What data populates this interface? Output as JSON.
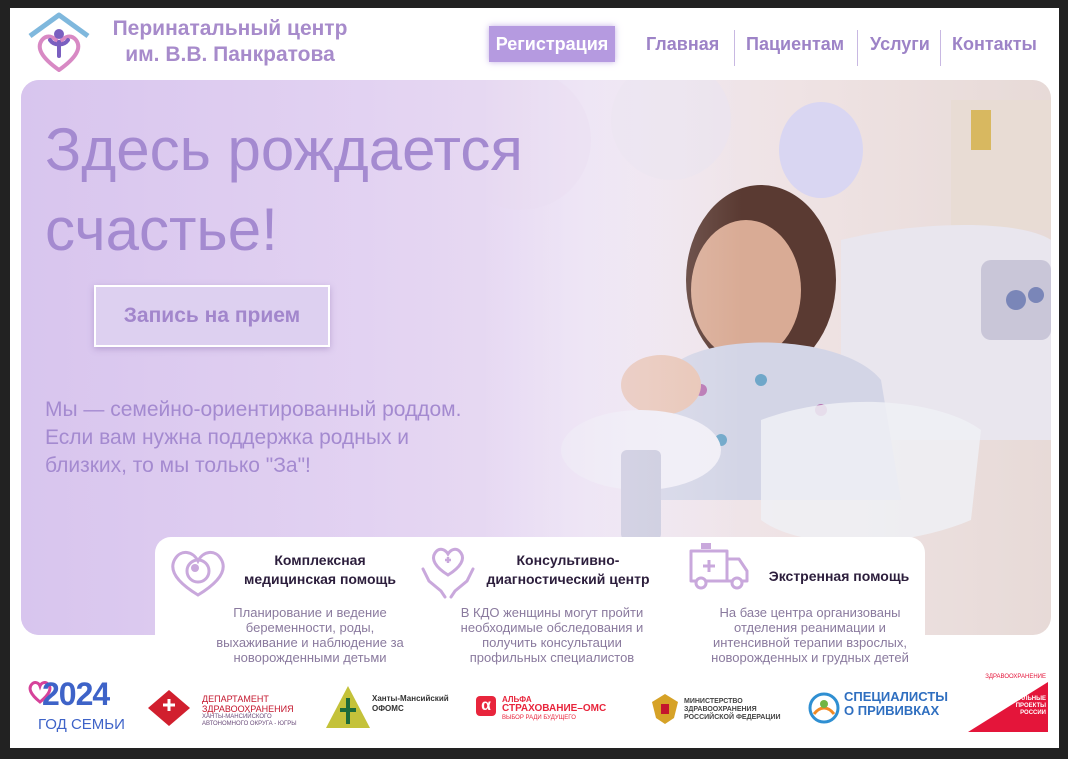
{
  "header": {
    "brand_line1": "Перинатальный центр",
    "brand_line2": "им. В.В. Панкратова",
    "register_label": "Регистрация",
    "nav": [
      {
        "label": "Главная"
      },
      {
        "label": "Пациентам"
      },
      {
        "label": "Услуги"
      },
      {
        "label": "Контакты"
      }
    ]
  },
  "hero": {
    "title_line1": "Здесь рождается",
    "title_line2": "счастье!",
    "cta_label": "Запись на прием",
    "sub_line1": "Мы — семейно-ориентированный роддом.",
    "sub_line2": "Если вам нужна поддержка родных и",
    "sub_line3": "близких, то мы только \"За\"!"
  },
  "services": [
    {
      "icon": "heart-baby-icon",
      "title_line1": "Комплексная",
      "title_line2": "медицинская помощь",
      "desc_line1": "Планирование и ведение",
      "desc_line2": "беременности, роды,",
      "desc_line3": "выхаживание и наблюдение за",
      "desc_line4": "новорожденными детьми"
    },
    {
      "icon": "hands-heart-icon",
      "title_line1": "Консультивно-",
      "title_line2": "диагностический центр",
      "desc_line1": "В КДО женщины могут пройти",
      "desc_line2": "необходимые обследования и",
      "desc_line3": "получить консультации",
      "desc_line4": "профильных специалистов"
    },
    {
      "icon": "ambulance-icon",
      "title_line1": "Экстренная помощь",
      "desc_line1": "На базе центра организованы",
      "desc_line2": "отделения реанимации и",
      "desc_line3": "интенсивной терапии взрослых,",
      "desc_line4": "новорожденных и грудных детей"
    }
  ],
  "footer": {
    "year_logo_number": "2024",
    "year_logo_text": "ГОД СЕМЬИ",
    "dept_line1": "ДЕПАРТАМЕНТ",
    "dept_line2": "ЗДРАВООХРАНЕНИЯ",
    "dept_small1": "ХАНТЫ-МАНСИЙСКОГО",
    "dept_small2": "АВТОНОМНОГО ОКРУГА - ЮГРЫ",
    "foms_line1": "Ханты-Мансийский",
    "foms_line2": "ОФОМС",
    "alfa_line1": "АЛЬФА",
    "alfa_line2": "СТРАХОВАНИЕ–ОМС",
    "alfa_line3": "ВЫБОР РАДИ БУДУЩЕГО",
    "minzdrav_line1": "МИНИСТЕРСТВО",
    "minzdrav_line2": "ЗДРАВООХРАНЕНИЯ",
    "minzdrav_line3": "РОССИЙСКОЙ ФЕДЕРАЦИИ",
    "vacc_line1": "СПЕЦИАЛИСТЫ",
    "vacc_line2": "О ПРИВИВКАХ",
    "np_top": "ЗДРАВООХРАНЕНИЕ",
    "np_line1": "НАЦИОНАЛЬНЫЕ",
    "np_line2": "ПРОЕКТЫ",
    "np_line3": "РОССИИ"
  },
  "colors": {
    "brand_purple": "#a78bcb",
    "register_bg": "#b59ae0",
    "hero_text": "#a48ad0"
  }
}
